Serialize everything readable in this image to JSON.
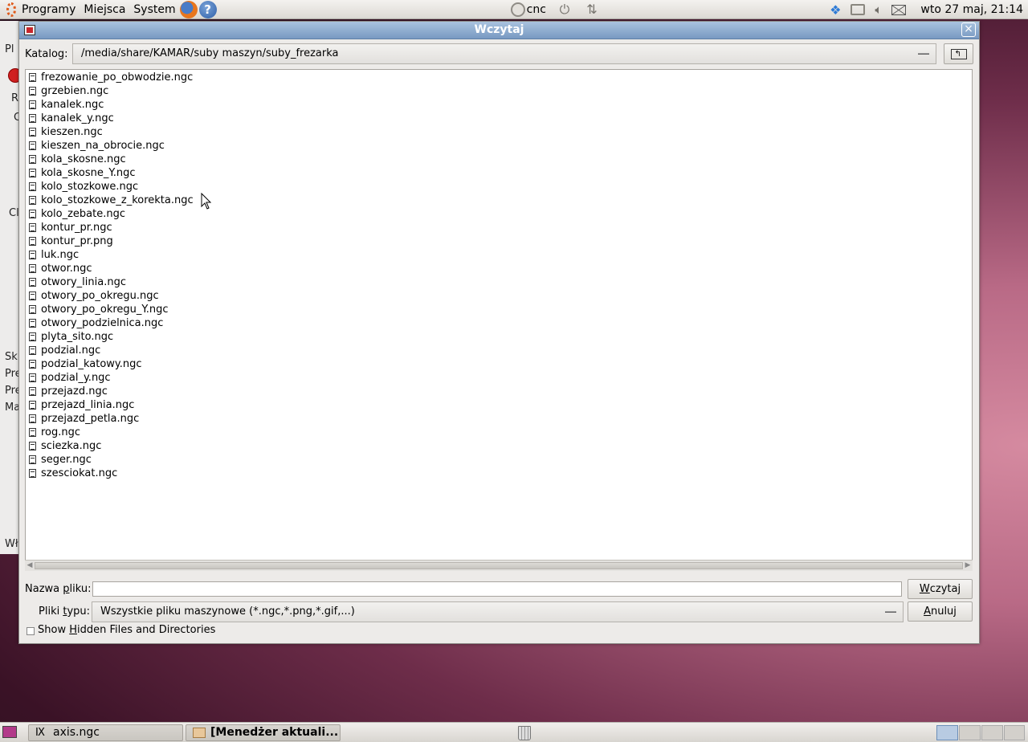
{
  "top_panel": {
    "menus": [
      "Programy",
      "Miejsca",
      "System"
    ],
    "user": "cnc",
    "clock": "wto 27 maj, 21:14",
    "icons": [
      "ubuntu-logo-icon",
      "firefox-icon",
      "help-icon",
      "user-status-icon",
      "power-icon",
      "network-icon",
      "dropbox-icon",
      "display-icon",
      "volume-icon",
      "mail-icon"
    ]
  },
  "background_window": {
    "fragments": [
      "Pl",
      "R",
      "C",
      "Cl",
      "Sk",
      "Pre",
      "Pre",
      "Ma",
      "Wł"
    ]
  },
  "dialog": {
    "title": "Wczytaj",
    "katalog_label": "Katalog:",
    "path": "/media/share/KAMAR/suby maszyn/suby_frezarka",
    "files": [
      "frezowanie_po_obwodzie.ngc",
      "grzebien.ngc",
      "kanalek.ngc",
      "kanalek_y.ngc",
      "kieszen.ngc",
      "kieszen_na_obrocie.ngc",
      "kola_skosne.ngc",
      "kola_skosne_Y.ngc",
      "kolo_stozkowe.ngc",
      "kolo_stozkowe_z_korekta.ngc",
      "kolo_zebate.ngc",
      "kontur_pr.ngc",
      "kontur_pr.png",
      "luk.ngc",
      "otwor.ngc",
      "otwory_linia.ngc",
      "otwory_po_okregu.ngc",
      "otwory_po_okregu_Y.ngc",
      "otwory_podzielnica.ngc",
      "plyta_sito.ngc",
      "podzial.ngc",
      "podzial_katowy.ngc",
      "podzial_y.ngc",
      "przejazd.ngc",
      "przejazd_linia.ngc",
      "przejazd_petla.ngc",
      "rog.ngc",
      "sciezka.ngc",
      "seger.ngc",
      "szesciokat.ngc"
    ],
    "filename_label_pre": "Nazwa ",
    "filename_label_ul": "p",
    "filename_label_post": "liku:",
    "filename_value": "",
    "load_button_pre": "",
    "load_button_ul": "W",
    "load_button_post": "czytaj",
    "filetype_label_pre": "Pliki ",
    "filetype_label_ul": "t",
    "filetype_label_post": "ypu:",
    "filetype_value": "Wszystkie pliku maszynowe (*.ngc,*.png,*.gif,...)",
    "cancel_button_pre": "",
    "cancel_button_ul": "A",
    "cancel_button_post": "nuluj",
    "hidden_pre": "Show ",
    "hidden_ul": "H",
    "hidden_post": "idden Files and Directories",
    "hidden_checked": false
  },
  "bottom_panel": {
    "tasks": [
      "axis.ngc",
      "[Menedżer aktuali..."
    ],
    "workspace_count": 4,
    "active_workspace": 1
  }
}
